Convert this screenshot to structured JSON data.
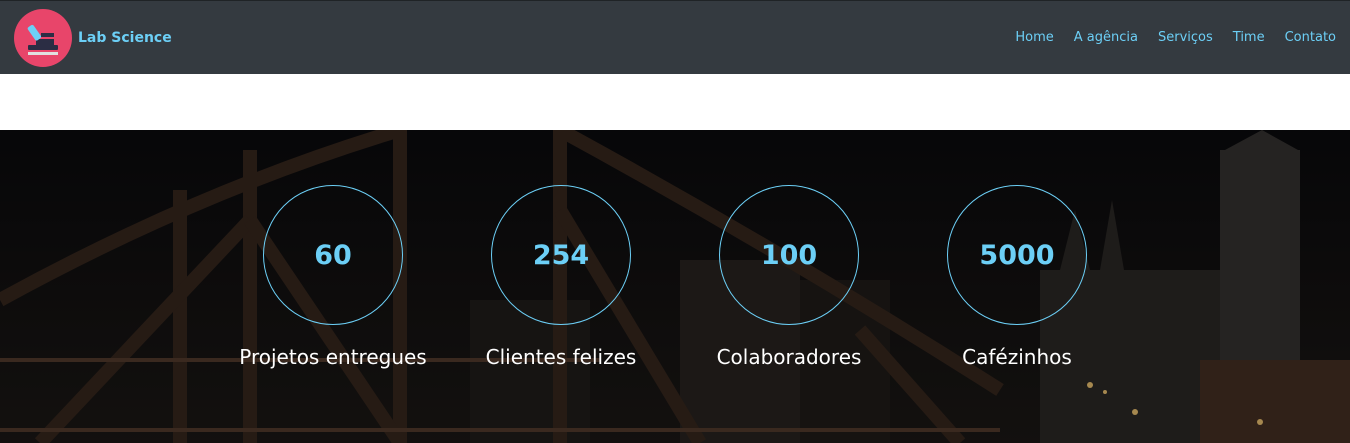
{
  "brand": {
    "name": "Lab Science",
    "logo_icon": "microscope-icon",
    "logo_bg": "#e8456a"
  },
  "nav": {
    "items": [
      {
        "label": "Home"
      },
      {
        "label": "A agência"
      },
      {
        "label": "Serviços"
      },
      {
        "label": "Time"
      },
      {
        "label": "Contato"
      }
    ]
  },
  "stats": [
    {
      "value": "60",
      "label": "Projetos entregues"
    },
    {
      "value": "254",
      "label": "Clientes felizes"
    },
    {
      "value": "100",
      "label": "Colaboradores"
    },
    {
      "value": "5000",
      "label": "Cafézinhos"
    }
  ],
  "colors": {
    "navbar": "#343a40",
    "accent": "#6ccff6",
    "hero_bg": "#0d0d10"
  }
}
